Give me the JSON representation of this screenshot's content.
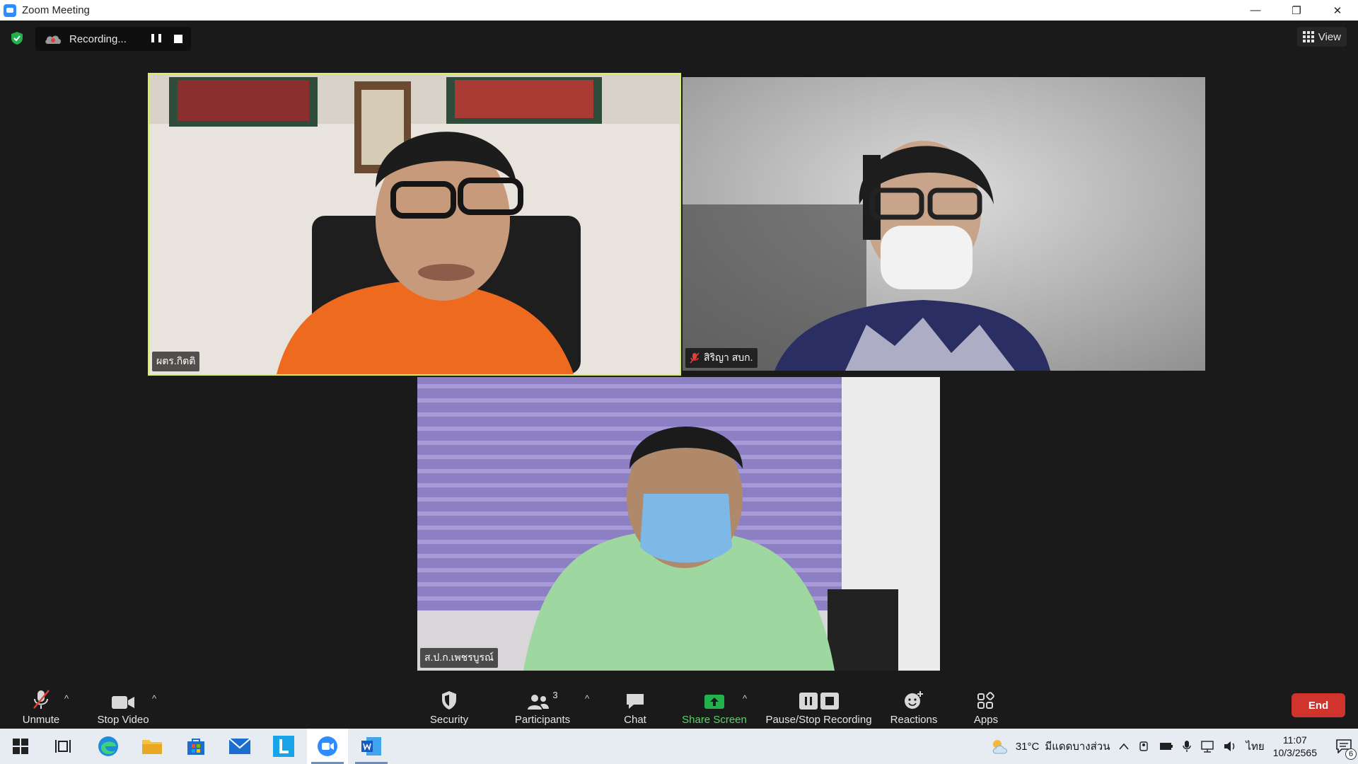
{
  "window": {
    "title": "Zoom Meeting",
    "minimize": "—",
    "restore": "❐",
    "close": "✕"
  },
  "meeting": {
    "recording_label": "Recording...",
    "view_label": "View"
  },
  "participants": [
    {
      "name": "ผตร.กิตติ",
      "muted": false,
      "active_speaker": true
    },
    {
      "name": "สิริญา สบก.",
      "muted": true,
      "active_speaker": false
    },
    {
      "name": "ส.ป.ก.เพชรบูรณ์",
      "muted": false,
      "active_speaker": false
    }
  ],
  "toolbar": {
    "unmute": "Unmute",
    "stop_video": "Stop Video",
    "security": "Security",
    "participants": "Participants",
    "participants_count": "3",
    "chat": "Chat",
    "share_screen": "Share Screen",
    "pause_stop_recording": "Pause/Stop Recording",
    "reactions": "Reactions",
    "apps": "Apps",
    "end": "End",
    "caret": "^"
  },
  "taskbar": {
    "apps": [
      "windows-start",
      "task-view",
      "edge",
      "file-explorer",
      "store",
      "mail",
      "l-app",
      "zoom",
      "word"
    ],
    "weather_temp": "31°C",
    "weather_text": "มีแดดบางส่วน",
    "language": "ไทย",
    "time": "11:07",
    "date": "10/3/2565",
    "notification_count": "6"
  },
  "colors": {
    "active_speaker_border": "#d8f05a",
    "end_button": "#d1332d",
    "share_green": "#5ad36a",
    "zoom_blue": "#2d8cff"
  }
}
